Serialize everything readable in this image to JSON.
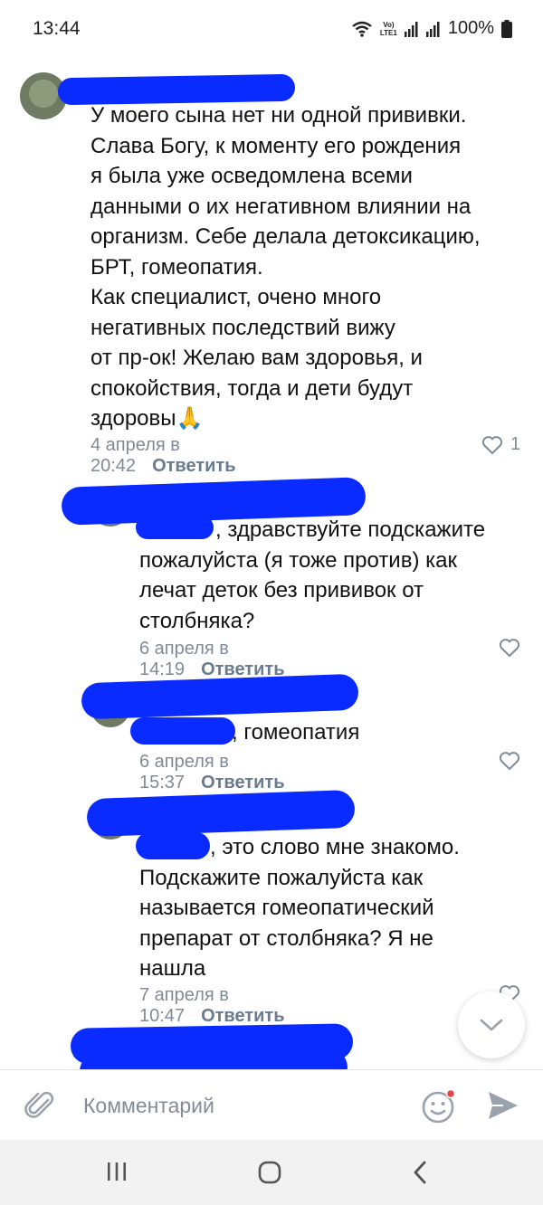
{
  "status_bar": {
    "time": "13:44",
    "network_label_top": "Vo)",
    "network_label_bottom": "LTE1",
    "battery": "100%",
    "icons": [
      "wifi-icon",
      "volte-icon",
      "signal-icon",
      "signal-icon",
      "battery-icon"
    ]
  },
  "comments": [
    {
      "text": "У моего сына нет ни одной прививки.\nСлава Богу, к моменту его рождения\nя была уже осведомлена всеми\nданными о их негативном влиянии на\nорганизм. Себе делала детоксикацию,\nБРТ, гомеопатия.\nКак специалист, очено много\nнегативных последствий вижу\nот пр-ок!  Желаю вам здоровья, и\nспокойствия, тогда и дети будут\nздоровы🙏",
      "date": "4 апреля в 20:42",
      "reply": "Ответить",
      "likes": "1"
    },
    {
      "text": ", здравствуйте подскажите\nпожалуйста (я тоже против) как\nлечат деток без прививок от\nстолбняка?",
      "date": "6 апреля в 14:19",
      "reply": "Ответить"
    },
    {
      "text": ", гомеопатия",
      "date": "6 апреля в 15:37",
      "reply": "Ответить"
    },
    {
      "text": ", это слово мне знакомо.\nПодскажите пожалуйста как\nназывается гомеопатический\nпрепарат от столбняка? Я не\nнашла",
      "date": "7 апреля в 10:47",
      "reply": "Ответить"
    }
  ],
  "composer": {
    "placeholder": "Комментарий",
    "icons": [
      "attach-icon",
      "emoji-icon",
      "send-icon"
    ]
  },
  "fab": {
    "icon": "chevron-down-icon"
  },
  "nav": {
    "icons": [
      "recents-icon",
      "home-icon",
      "back-icon"
    ]
  },
  "colors": {
    "accent": "#99a2ad",
    "redaction": "#0a2bff",
    "meta": "#808a97",
    "badge": "#e64646"
  }
}
